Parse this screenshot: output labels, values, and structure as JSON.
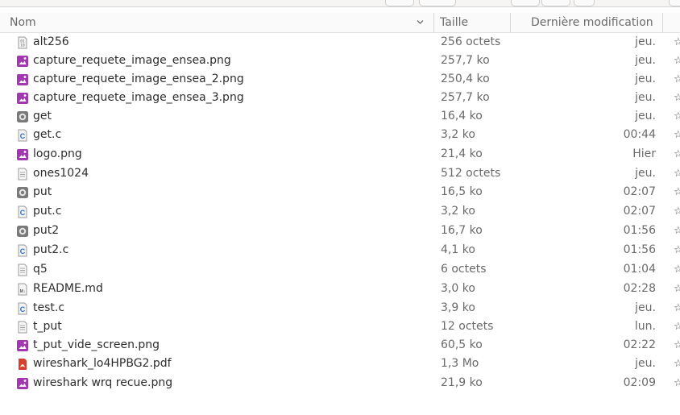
{
  "columns": {
    "name": "Nom",
    "size": "Taille",
    "modified": "Dernière modification"
  },
  "colors": {
    "image": "#a238b0",
    "source": "#2b6fcf",
    "pdf": "#d6402f",
    "exec": "#7a7a7a"
  },
  "files": [
    {
      "name": "alt256",
      "size": "256 octets",
      "modified": "jeu.",
      "icon": "binary-file-icon"
    },
    {
      "name": "capture_requete_image_ensea.png",
      "size": "257,7 ko",
      "modified": "jeu.",
      "icon": "image-file-icon"
    },
    {
      "name": "capture_requete_image_ensea_2.png",
      "size": "250,4 ko",
      "modified": "jeu.",
      "icon": "image-file-icon"
    },
    {
      "name": "capture_requete_image_ensea_3.png",
      "size": "257,7 ko",
      "modified": "jeu.",
      "icon": "image-file-icon"
    },
    {
      "name": "get",
      "size": "16,4 ko",
      "modified": "jeu.",
      "icon": "executable-file-icon"
    },
    {
      "name": "get.c",
      "size": "3,2 ko",
      "modified": "00:44",
      "icon": "c-source-file-icon"
    },
    {
      "name": "logo.png",
      "size": "21,4 ko",
      "modified": "Hier",
      "icon": "image-file-icon"
    },
    {
      "name": "ones1024",
      "size": "512 octets",
      "modified": "jeu.",
      "icon": "text-file-icon"
    },
    {
      "name": "put",
      "size": "16,5 ko",
      "modified": "02:07",
      "icon": "executable-file-icon"
    },
    {
      "name": "put.c",
      "size": "3,2 ko",
      "modified": "02:07",
      "icon": "c-source-file-icon"
    },
    {
      "name": "put2",
      "size": "16,7 ko",
      "modified": "01:56",
      "icon": "executable-file-icon"
    },
    {
      "name": "put2.c",
      "size": "4,1 ko",
      "modified": "01:56",
      "icon": "c-source-file-icon"
    },
    {
      "name": "q5",
      "size": "6 octets",
      "modified": "01:04",
      "icon": "text-file-icon"
    },
    {
      "name": "README.md",
      "size": "3,0 ko",
      "modified": "02:28",
      "icon": "markdown-file-icon"
    },
    {
      "name": "test.c",
      "size": "3,9 ko",
      "modified": "jeu.",
      "icon": "c-source-file-icon"
    },
    {
      "name": "t_put",
      "size": "12 octets",
      "modified": "lun.",
      "icon": "text-file-icon"
    },
    {
      "name": "t_put_vide_screen.png",
      "size": "60,5 ko",
      "modified": "02:22",
      "icon": "image-file-icon"
    },
    {
      "name": "wireshark_lo4HPBG2.pdf",
      "size": "1,3 Mo",
      "modified": "jeu.",
      "icon": "pdf-file-icon"
    },
    {
      "name": "wireshark wrq recue.png",
      "size": "21,9 ko",
      "modified": "02:09",
      "icon": "image-file-icon"
    }
  ]
}
